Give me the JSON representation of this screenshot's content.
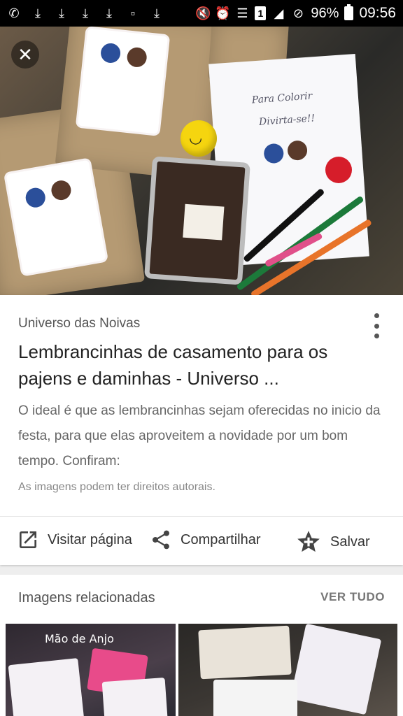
{
  "status_bar": {
    "battery": "96%",
    "time": "09:56",
    "sim": "1"
  },
  "hero": {
    "close_icon": "close-icon",
    "paper_line1": "Para Colorir",
    "paper_line2": "Divirta-se!!"
  },
  "result": {
    "source": "Universo das Noivas",
    "title": "Lembrancinhas de casamento para os pajens e daminhas - Universo ...",
    "description": "O ideal é que as lembrancinhas sejam oferecidas no inicio da festa, para que elas aproveitem a novidade por um bom tempo. Confiram:",
    "copyright": "As imagens podem ter direitos autorais."
  },
  "actions": {
    "visit": "Visitar página",
    "share": "Compartilhar",
    "save": "Salvar"
  },
  "related": {
    "title": "Imagens relacionadas",
    "see_all": "VER TUDO",
    "thumb1_caption": "Mão de Anjo"
  },
  "colors": {
    "accent_text": "#222222",
    "muted_text": "#666666",
    "status_bar_bg": "#000000"
  }
}
